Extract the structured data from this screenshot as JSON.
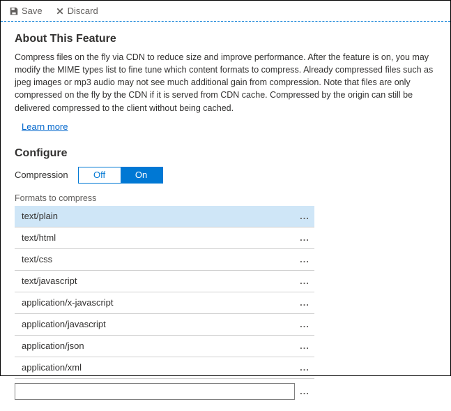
{
  "toolbar": {
    "save": "Save",
    "discard": "Discard"
  },
  "about": {
    "title": "About This Feature",
    "description": "Compress files on the fly via CDN to reduce size and improve performance. After the feature is on, you may modify the MIME types list to fine tune which content formats to compress. Already compressed files such as jpeg images or mp3 audio may not see much additional gain from compression. Note that files are only compressed on the fly by the CDN if it is served from CDN cache. Compressed by the origin can still be delivered compressed to the client without being cached.",
    "learn_more": "Learn more"
  },
  "configure": {
    "title": "Configure",
    "compression_label": "Compression",
    "off": "Off",
    "on": "On",
    "formats_label": "Formats to compress",
    "formats": [
      "text/plain",
      "text/html",
      "text/css",
      "text/javascript",
      "application/x-javascript",
      "application/javascript",
      "application/json",
      "application/xml"
    ],
    "add_placeholder": ""
  }
}
